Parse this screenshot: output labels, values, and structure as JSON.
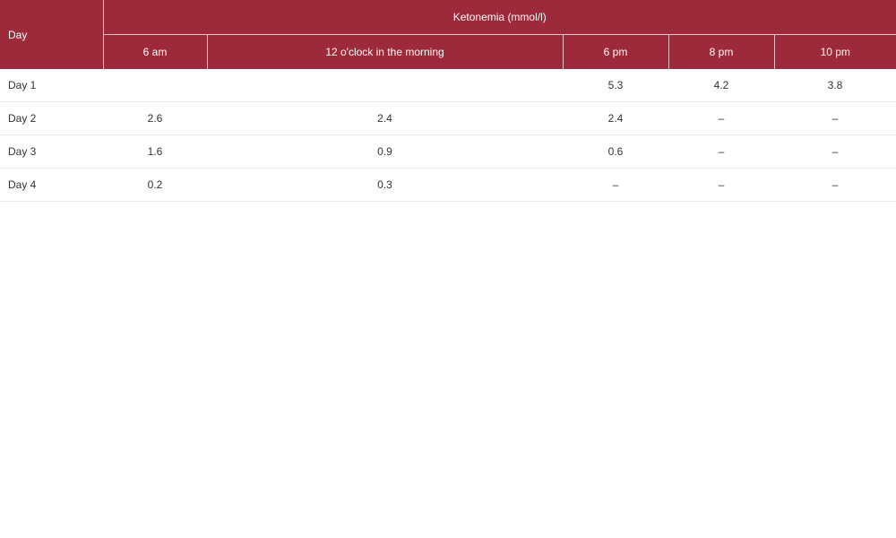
{
  "table": {
    "row_header": "Day",
    "group_header": "Ketonemia (mmol/l)",
    "columns": [
      "6 am",
      "12 o'clock in the morning",
      "6 pm",
      "8 pm",
      "10 pm"
    ],
    "rows": [
      {
        "day": "Day 1",
        "values": [
          "",
          "",
          "5.3",
          "4.2",
          "3.8"
        ]
      },
      {
        "day": "Day 2",
        "values": [
          "2.6",
          "2.4",
          "2.4",
          "–",
          "–"
        ]
      },
      {
        "day": "Day 3",
        "values": [
          "1.6",
          "0.9",
          "0.6",
          "–",
          "–"
        ]
      },
      {
        "day": "Day 4",
        "values": [
          "0.2",
          "0.3",
          "–",
          "–",
          "–"
        ]
      }
    ]
  },
  "colors": {
    "header_bg": "#9d2a3a",
    "header_text": "#ffffff",
    "row_divider": "#e9e9e9"
  }
}
